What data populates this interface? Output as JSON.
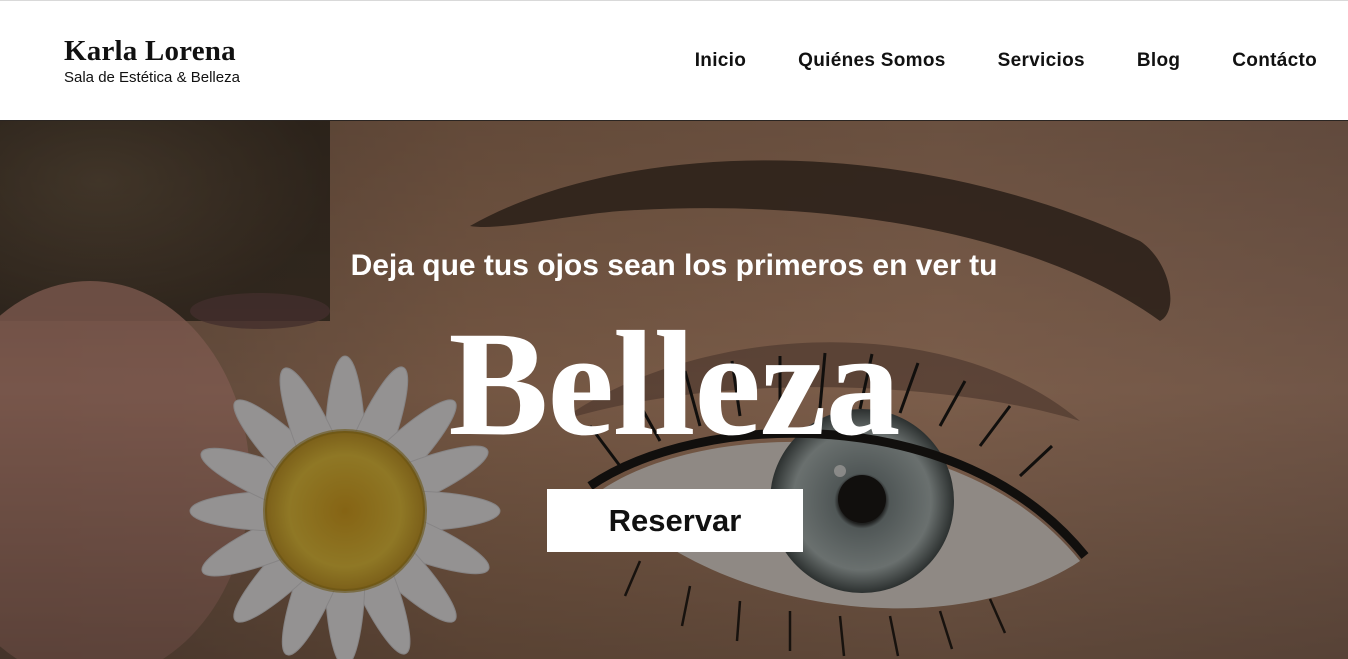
{
  "header": {
    "brand_name": "Karla Lorena",
    "brand_tagline": "Sala de Estética & Belleza",
    "nav": [
      {
        "label": "Inicio"
      },
      {
        "label": "Quiénes Somos"
      },
      {
        "label": "Servicios"
      },
      {
        "label": "Blog"
      },
      {
        "label": "Contácto"
      }
    ]
  },
  "hero": {
    "subtitle": "Deja que tus ojos sean los primeros en ver tu",
    "title": "Belleza",
    "button_label": "Reservar"
  },
  "colors": {
    "header_bg": "#ffffff",
    "text_dark": "#111111",
    "hero_text": "#ffffff",
    "button_bg": "#ffffff"
  }
}
